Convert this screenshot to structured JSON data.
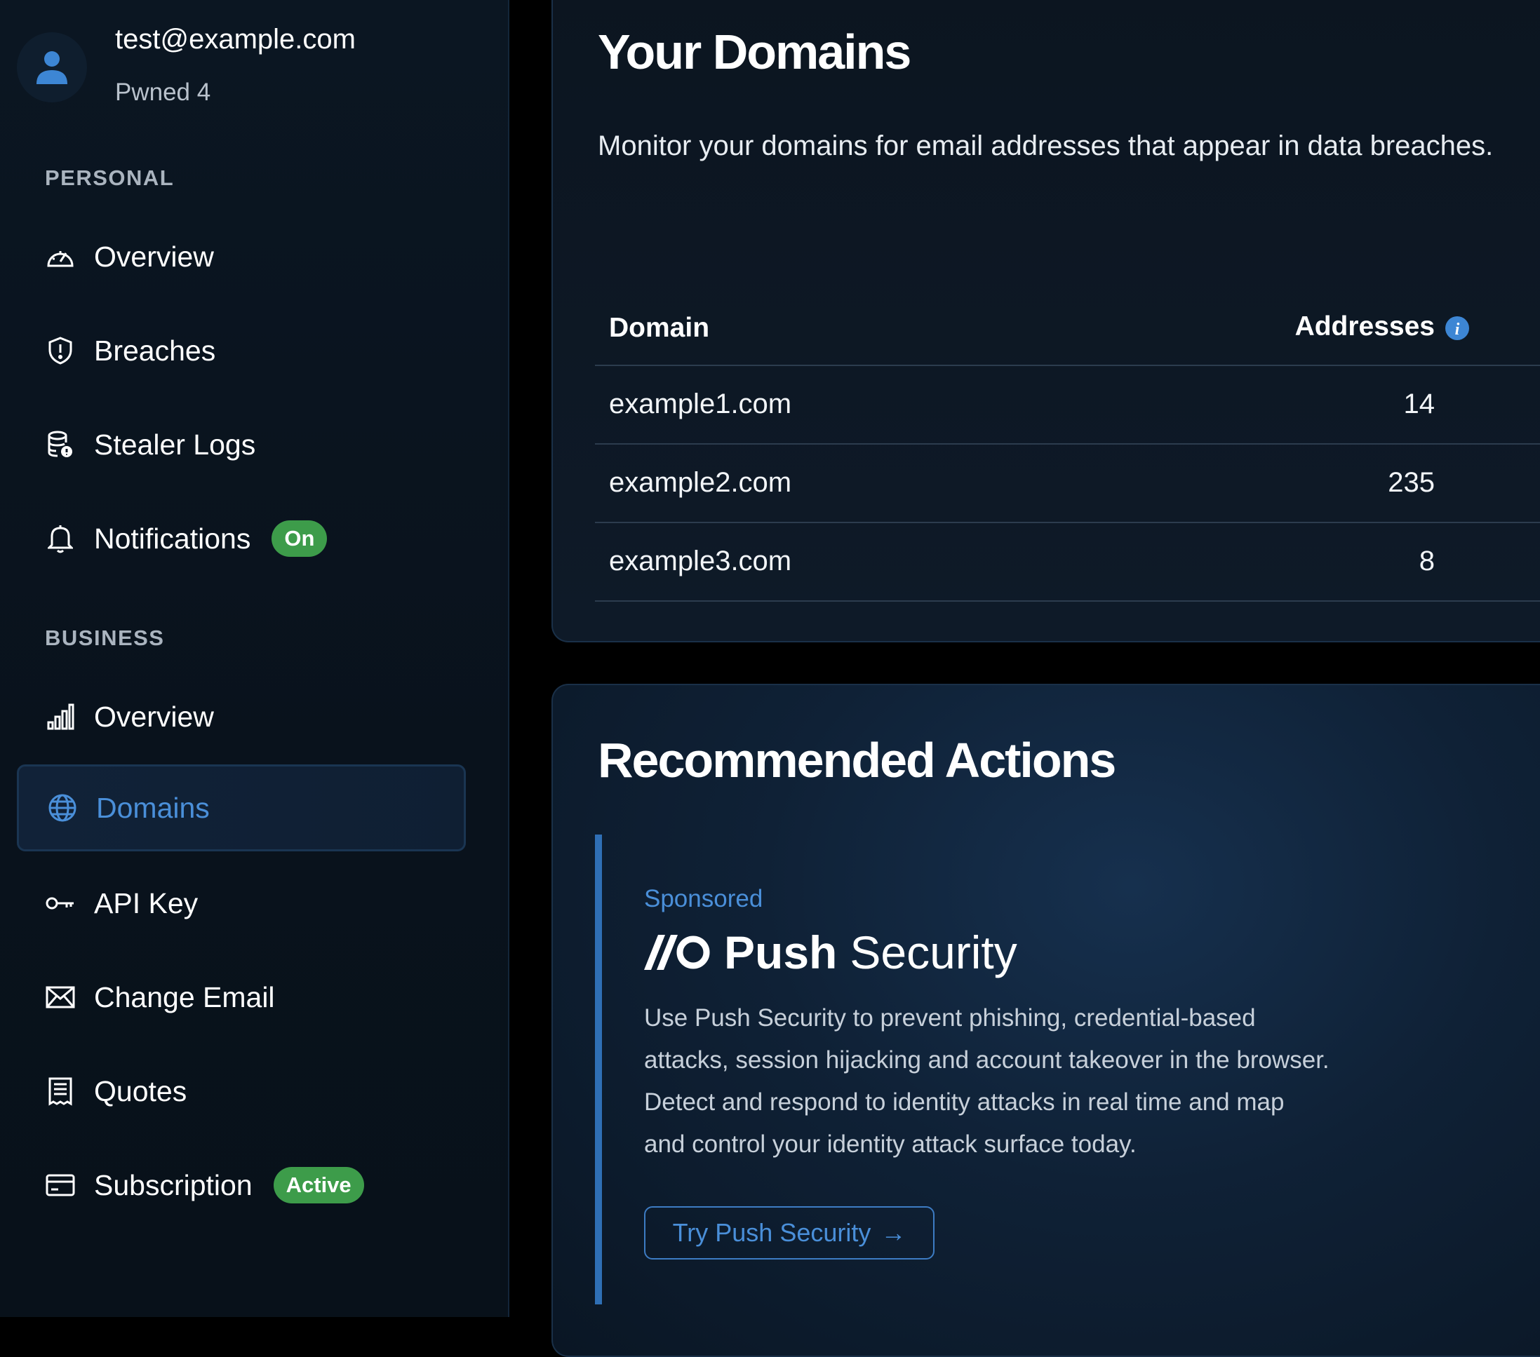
{
  "user": {
    "email": "test@example.com",
    "pwned": "Pwned 4"
  },
  "sidebar": {
    "personal_title": "PERSONAL",
    "business_title": "BUSINESS",
    "personal_items": [
      {
        "label": "Overview",
        "icon": "gauge-icon"
      },
      {
        "label": "Breaches",
        "icon": "shield-alert-icon"
      },
      {
        "label": "Stealer Logs",
        "icon": "database-alert-icon"
      },
      {
        "label": "Notifications",
        "icon": "bell-icon",
        "badge": "On"
      }
    ],
    "business_items": [
      {
        "label": "Overview",
        "icon": "bar-chart-icon"
      },
      {
        "label": "Domains",
        "icon": "globe-icon",
        "active": true
      },
      {
        "label": "API Key",
        "icon": "key-icon"
      },
      {
        "label": "Change Email",
        "icon": "envelope-icon"
      },
      {
        "label": "Quotes",
        "icon": "receipt-icon"
      },
      {
        "label": "Subscription",
        "icon": "credit-card-icon",
        "badge": "Active"
      }
    ]
  },
  "main": {
    "title": "Your Domains",
    "description": "Monitor your domains for email addresses that appear in data breaches.",
    "table": {
      "headers": {
        "domain": "Domain",
        "addresses": "Addresses"
      },
      "rows": [
        {
          "domain": "example1.com",
          "addresses": "14"
        },
        {
          "domain": "example2.com",
          "addresses": "235"
        },
        {
          "domain": "example3.com",
          "addresses": "8"
        }
      ]
    },
    "recommended": {
      "title": "Recommended Actions",
      "sponsored_label": "Sponsored",
      "brand_bold": "Push",
      "brand_light": "Security",
      "description": "Use Push Security to prevent phishing, credential-based attacks, session hijacking and account takeover in the browser. Detect and respond to identity attacks in real time and map and control your identity attack surface today.",
      "button_label": "Try Push Security"
    }
  },
  "colors": {
    "accent": "#4a8fd9",
    "badge_green": "#3d9c4a",
    "background": "#000000"
  }
}
